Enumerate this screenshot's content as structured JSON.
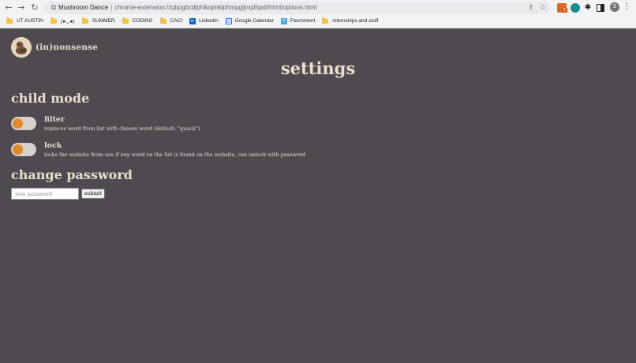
{
  "browser": {
    "tab_title": "Mushroom Dance",
    "separator": "|",
    "url": "chrome-extension://cjbpgbcdlphlkojmklphmpgijmplhpdl/html/options.html",
    "nav": {
      "back": "←",
      "forward": "→",
      "reload": "↻"
    },
    "profile_initial": "S",
    "extension_badge": "1",
    "bookmarks": [
      {
        "label": "UT AUSTIN",
        "icon": "folder-icon"
      },
      {
        "label": "(●◡●)",
        "icon": "folder-icon"
      },
      {
        "label": "SUMMER",
        "icon": "folder-icon"
      },
      {
        "label": "CODING",
        "icon": "folder-icon"
      },
      {
        "label": "CACI",
        "icon": "folder-icon"
      },
      {
        "label": "LinkedIn",
        "icon": "linkedin-icon",
        "glyph": "in"
      },
      {
        "label": "Google Calendar",
        "icon": "calendar-icon",
        "glyph": "31"
      },
      {
        "label": "Parchment",
        "icon": "parchment-icon",
        "glyph": "P"
      },
      {
        "label": "internships and stuff",
        "icon": "folder-icon"
      }
    ]
  },
  "header": {
    "brand": "(in)nonsense",
    "title": "settings"
  },
  "child_mode": {
    "heading": "child mode",
    "filter": {
      "label": "filter",
      "description": "replaces word from list with chosen word (default: \"quack\")",
      "enabled": false
    },
    "lock": {
      "label": "lock",
      "description": "locks the website from use if any word on the list is found on the website, can unlock with password",
      "enabled": false
    }
  },
  "password": {
    "heading": "change password",
    "placeholder": "new password",
    "submit_label": "submit"
  },
  "colors": {
    "background": "#4f4a50",
    "text": "#e9dfcc",
    "toggle_knob": "#e08a2c",
    "toggle_track": "#d6d1cc"
  }
}
